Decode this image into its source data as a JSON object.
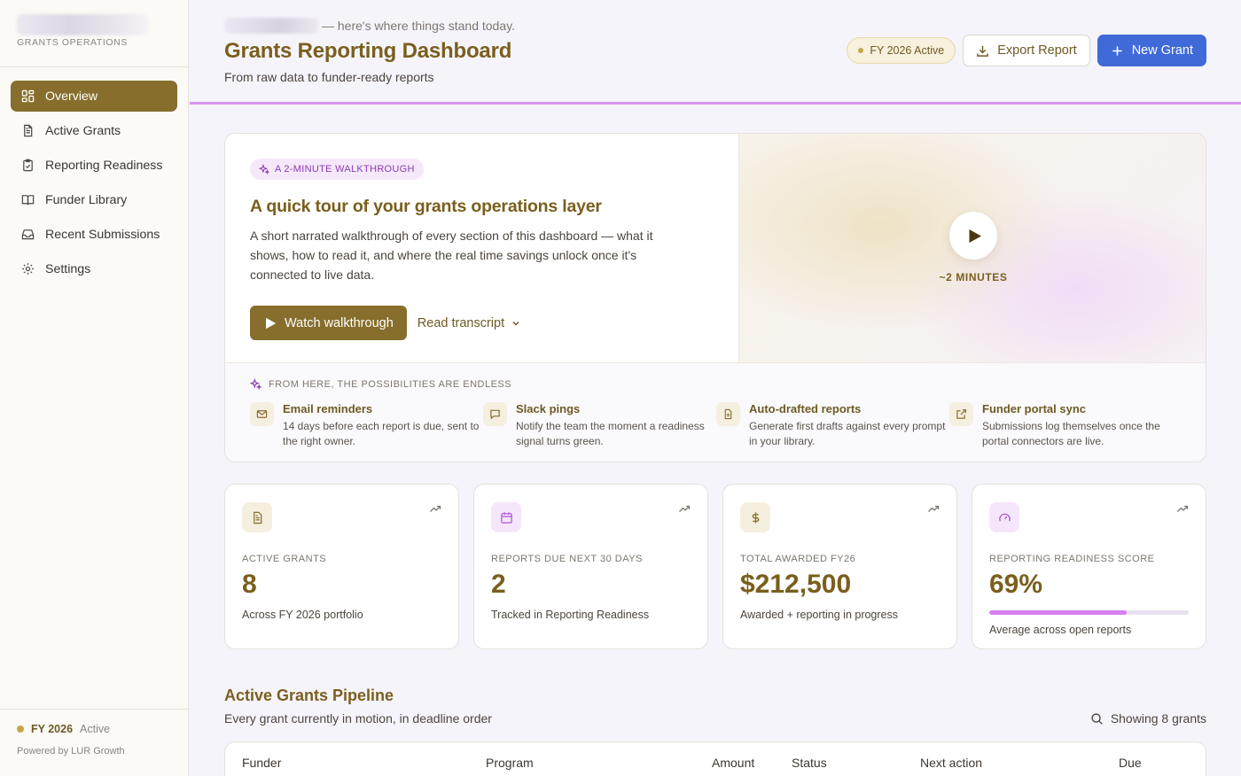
{
  "sidebar": {
    "org_subtitle": "GRANTS OPERATIONS",
    "items": [
      {
        "label": "Overview",
        "icon": "grid-icon",
        "active": true
      },
      {
        "label": "Active Grants",
        "icon": "document-icon"
      },
      {
        "label": "Reporting Readiness",
        "icon": "clipboard-check-icon"
      },
      {
        "label": "Funder Library",
        "icon": "book-icon"
      },
      {
        "label": "Recent Submissions",
        "icon": "inbox-icon"
      },
      {
        "label": "Settings",
        "icon": "gear-icon"
      }
    ],
    "footer": {
      "fy": "FY 2026",
      "status": "Active",
      "powered_by": "Powered by LUR Growth"
    }
  },
  "header": {
    "greeting_suffix": "— here's where things stand today.",
    "title": "Grants Reporting Dashboard",
    "subtitle": "From raw data to funder-ready reports",
    "fy_badge": "FY 2026 Active",
    "export_label": "Export Report",
    "new_grant_label": "New Grant"
  },
  "walkthrough": {
    "pill": "A 2-MINUTE WALKTHROUGH",
    "title": "A quick tour of your grants operations layer",
    "description": "A short narrated walkthrough of every section of this dashboard — what it shows, how to read it, and where the real time savings unlock once it's connected to live data.",
    "watch_label": "Watch walkthrough",
    "transcript_label": "Read transcript",
    "duration": "~2 MINUTES",
    "possibilities_heading": "FROM HERE, THE POSSIBILITIES ARE ENDLESS",
    "possibilities": [
      {
        "title": "Email reminders",
        "desc": "14 days before each report is due, sent to the right owner.",
        "icon": "mail-icon"
      },
      {
        "title": "Slack pings",
        "desc": "Notify the team the moment a readiness signal turns green.",
        "icon": "chat-icon"
      },
      {
        "title": "Auto-drafted reports",
        "desc": "Generate first drafts against every prompt in your library.",
        "icon": "document-icon"
      },
      {
        "title": "Funder portal sync",
        "desc": "Submissions log themselves once the portal connectors are live.",
        "icon": "external-link-icon"
      }
    ]
  },
  "stats": [
    {
      "label": "ACTIVE GRANTS",
      "value": "8",
      "note": "Across FY 2026 portfolio",
      "icon": "document-icon",
      "icon_bg": "#f5efe0",
      "icon_color": "#876e2c"
    },
    {
      "label": "REPORTS DUE NEXT 30 DAYS",
      "value": "2",
      "note": "Tracked in Reporting Readiness",
      "icon": "calendar-icon",
      "icon_bg": "#f6e6fb",
      "icon_color": "#b052d6"
    },
    {
      "label": "TOTAL AWARDED FY26",
      "value": "$212,500",
      "note": "Awarded + reporting in progress",
      "icon": "dollar-icon",
      "icon_bg": "#f5efe0",
      "icon_color": "#876e2c"
    },
    {
      "label": "REPORTING READINESS SCORE",
      "value": "69%",
      "note": "Average across open reports",
      "icon": "gauge-icon",
      "icon_bg": "#f6e6fb",
      "icon_color": "#b052d6",
      "progress": 0.69
    }
  ],
  "pipeline": {
    "title": "Active Grants Pipeline",
    "subtitle": "Every grant currently in motion, in deadline order",
    "showing": "Showing 8 grants",
    "columns": [
      "Funder",
      "Program",
      "Amount",
      "Status",
      "Next action",
      "Due"
    ]
  },
  "colors": {
    "brand_gold": "#876e2c",
    "accent_purple": "#d896ef",
    "primary_blue": "#3f6ad8"
  }
}
